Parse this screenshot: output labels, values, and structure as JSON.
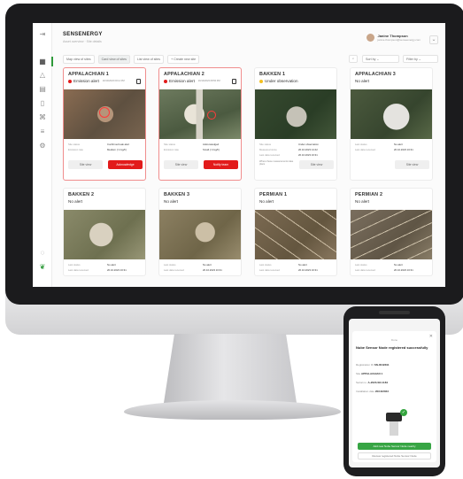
{
  "app": {
    "brand": "SENSENERGY",
    "subtitle": "Asset overview · Site details",
    "user_name": "Janine Thompson",
    "user_email": "janine.thompson@senseenergy.com"
  },
  "toolbar": {
    "views": [
      "Map view of sites",
      "Card view of sites",
      "List view of sites",
      "+ Create new site"
    ],
    "sort_label": "Sort by",
    "filter_label": "Filter by"
  },
  "cards": [
    {
      "title": "APPALACHIAN 1",
      "status": "Emission alert",
      "timestamp": "20/10/2023 09:14 PM",
      "status_color": "#e21b1b",
      "meta": [
        [
          "Site status",
          "Confirmed leak alert"
        ],
        [
          "Emission rate",
          "Medium (>1 kg/h)"
        ]
      ],
      "btn1": "Site view",
      "btn2": "Acknowledge"
    },
    {
      "title": "APPALACHIAN 2",
      "status": "Emission alert",
      "timestamp": "20/10/2023 08:56 PM",
      "status_color": "#e21b1b",
      "meta": [
        [
          "Site status",
          "Acknowledged"
        ],
        [
          "Emission rate",
          "Small (<1 kg/h)"
        ]
      ],
      "btn1": "Site view",
      "btn2": "Notify team"
    },
    {
      "title": "BAKKEN 1",
      "status": "Under observation",
      "timestamp": "",
      "status_color": "#f4c021",
      "meta": [
        [
          "Site status",
          "Under observation"
        ],
        [
          "Measured since",
          "20.10.2023 14:42"
        ],
        [
          "Last data received",
          "20.10.2023 16:31"
        ]
      ],
      "note": "Where these measurements take place",
      "btn1": "Site view",
      "btn2": ""
    },
    {
      "title": "APPALACHIAN 3",
      "status": "No alert",
      "timestamp": "",
      "status_color": "",
      "meta": [
        [
          "Last status",
          "No alert"
        ],
        [
          "Last data received",
          "20.10.2023 16:31"
        ]
      ],
      "btn1": "Site view",
      "btn2": ""
    },
    {
      "title": "BAKKEN 2",
      "status": "No alert",
      "meta": [
        [
          "Last status",
          "No alert"
        ],
        [
          "Last data received",
          "20.10.2023 16:31"
        ]
      ]
    },
    {
      "title": "BAKKEN 3",
      "status": "No alert",
      "meta": [
        [
          "Last status",
          "No alert"
        ],
        [
          "Last data received",
          "20.10.2023 16:31"
        ]
      ]
    },
    {
      "title": "PERMIAN 1",
      "status": "No alert",
      "meta": [
        [
          "Last status",
          "No alert"
        ],
        [
          "Last data received",
          "20.10.2023 16:31"
        ]
      ]
    },
    {
      "title": "PERMIAN 2",
      "status": "No alert",
      "meta": [
        [
          "Last status",
          "No alert"
        ],
        [
          "Last data received",
          "20.10.2023 16:31"
        ]
      ]
    }
  ],
  "nav_icons": [
    "collapse-icon",
    "grid-icon",
    "alert-icon",
    "building-icon",
    "device-icon",
    "team-icon",
    "list-icon",
    "settings-icon",
    "help-icon",
    "leaf-icon"
  ],
  "phone": {
    "ok": "Done",
    "title": "Nube Sensor Node registered successfully",
    "rows": [
      [
        "Registration ID",
        "SN-0042391"
      ],
      [
        "Site",
        "APPALACHIAN 1"
      ],
      [
        "Serial no.",
        "A-2023-SN-1184"
      ],
      [
        "Installation date",
        "20/10/2023"
      ]
    ],
    "primary": "Add new Nube Sensor Node nearby",
    "secondary": "Review registered Nube Sensor Node"
  }
}
